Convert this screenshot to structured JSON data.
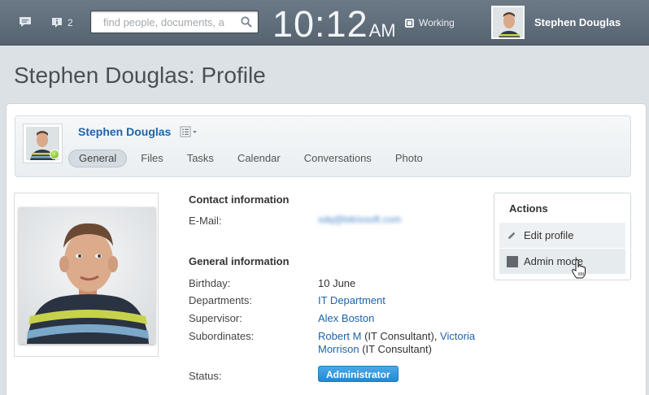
{
  "topbar": {
    "notification_count": "2",
    "search_placeholder": "find people, documents, a",
    "clock_time": "10:12",
    "clock_ampm": "AM",
    "work_status": "Working",
    "user_name": "Stephen Douglas"
  },
  "page": {
    "title": "Stephen Douglas: Profile"
  },
  "profile": {
    "name": "Stephen Douglas",
    "tabs": [
      {
        "label": "General",
        "active": true
      },
      {
        "label": "Files"
      },
      {
        "label": "Tasks"
      },
      {
        "label": "Calendar"
      },
      {
        "label": "Conversations"
      },
      {
        "label": "Photo"
      }
    ]
  },
  "contact": {
    "title": "Contact information",
    "email_label": "E-Mail:",
    "email_value": "sdq@bitrixsoft.com"
  },
  "general": {
    "title": "General information",
    "birthday_label": "Birthday:",
    "birthday_value": "10 June",
    "departments_label": "Departments:",
    "departments_value": "IT Department",
    "supervisor_label": "Supervisor:",
    "supervisor_value": "Alex Boston",
    "subordinates_label": "Subordinates:",
    "sub1_name": "Robert M",
    "sub1_role": " (IT Consultant), ",
    "sub2_name_a": "Victoria",
    "sub2_name_b": "Morrison",
    "sub2_role": " (IT Consultant)",
    "status_label": "Status:",
    "status_value": "Administrator"
  },
  "actions": {
    "title": "Actions",
    "edit_profile": "Edit profile",
    "admin_mode": "Admin mode"
  },
  "colors": {
    "link": "#1e64a8",
    "badge": "#2e93da",
    "topbar": "#5f6d7a"
  }
}
